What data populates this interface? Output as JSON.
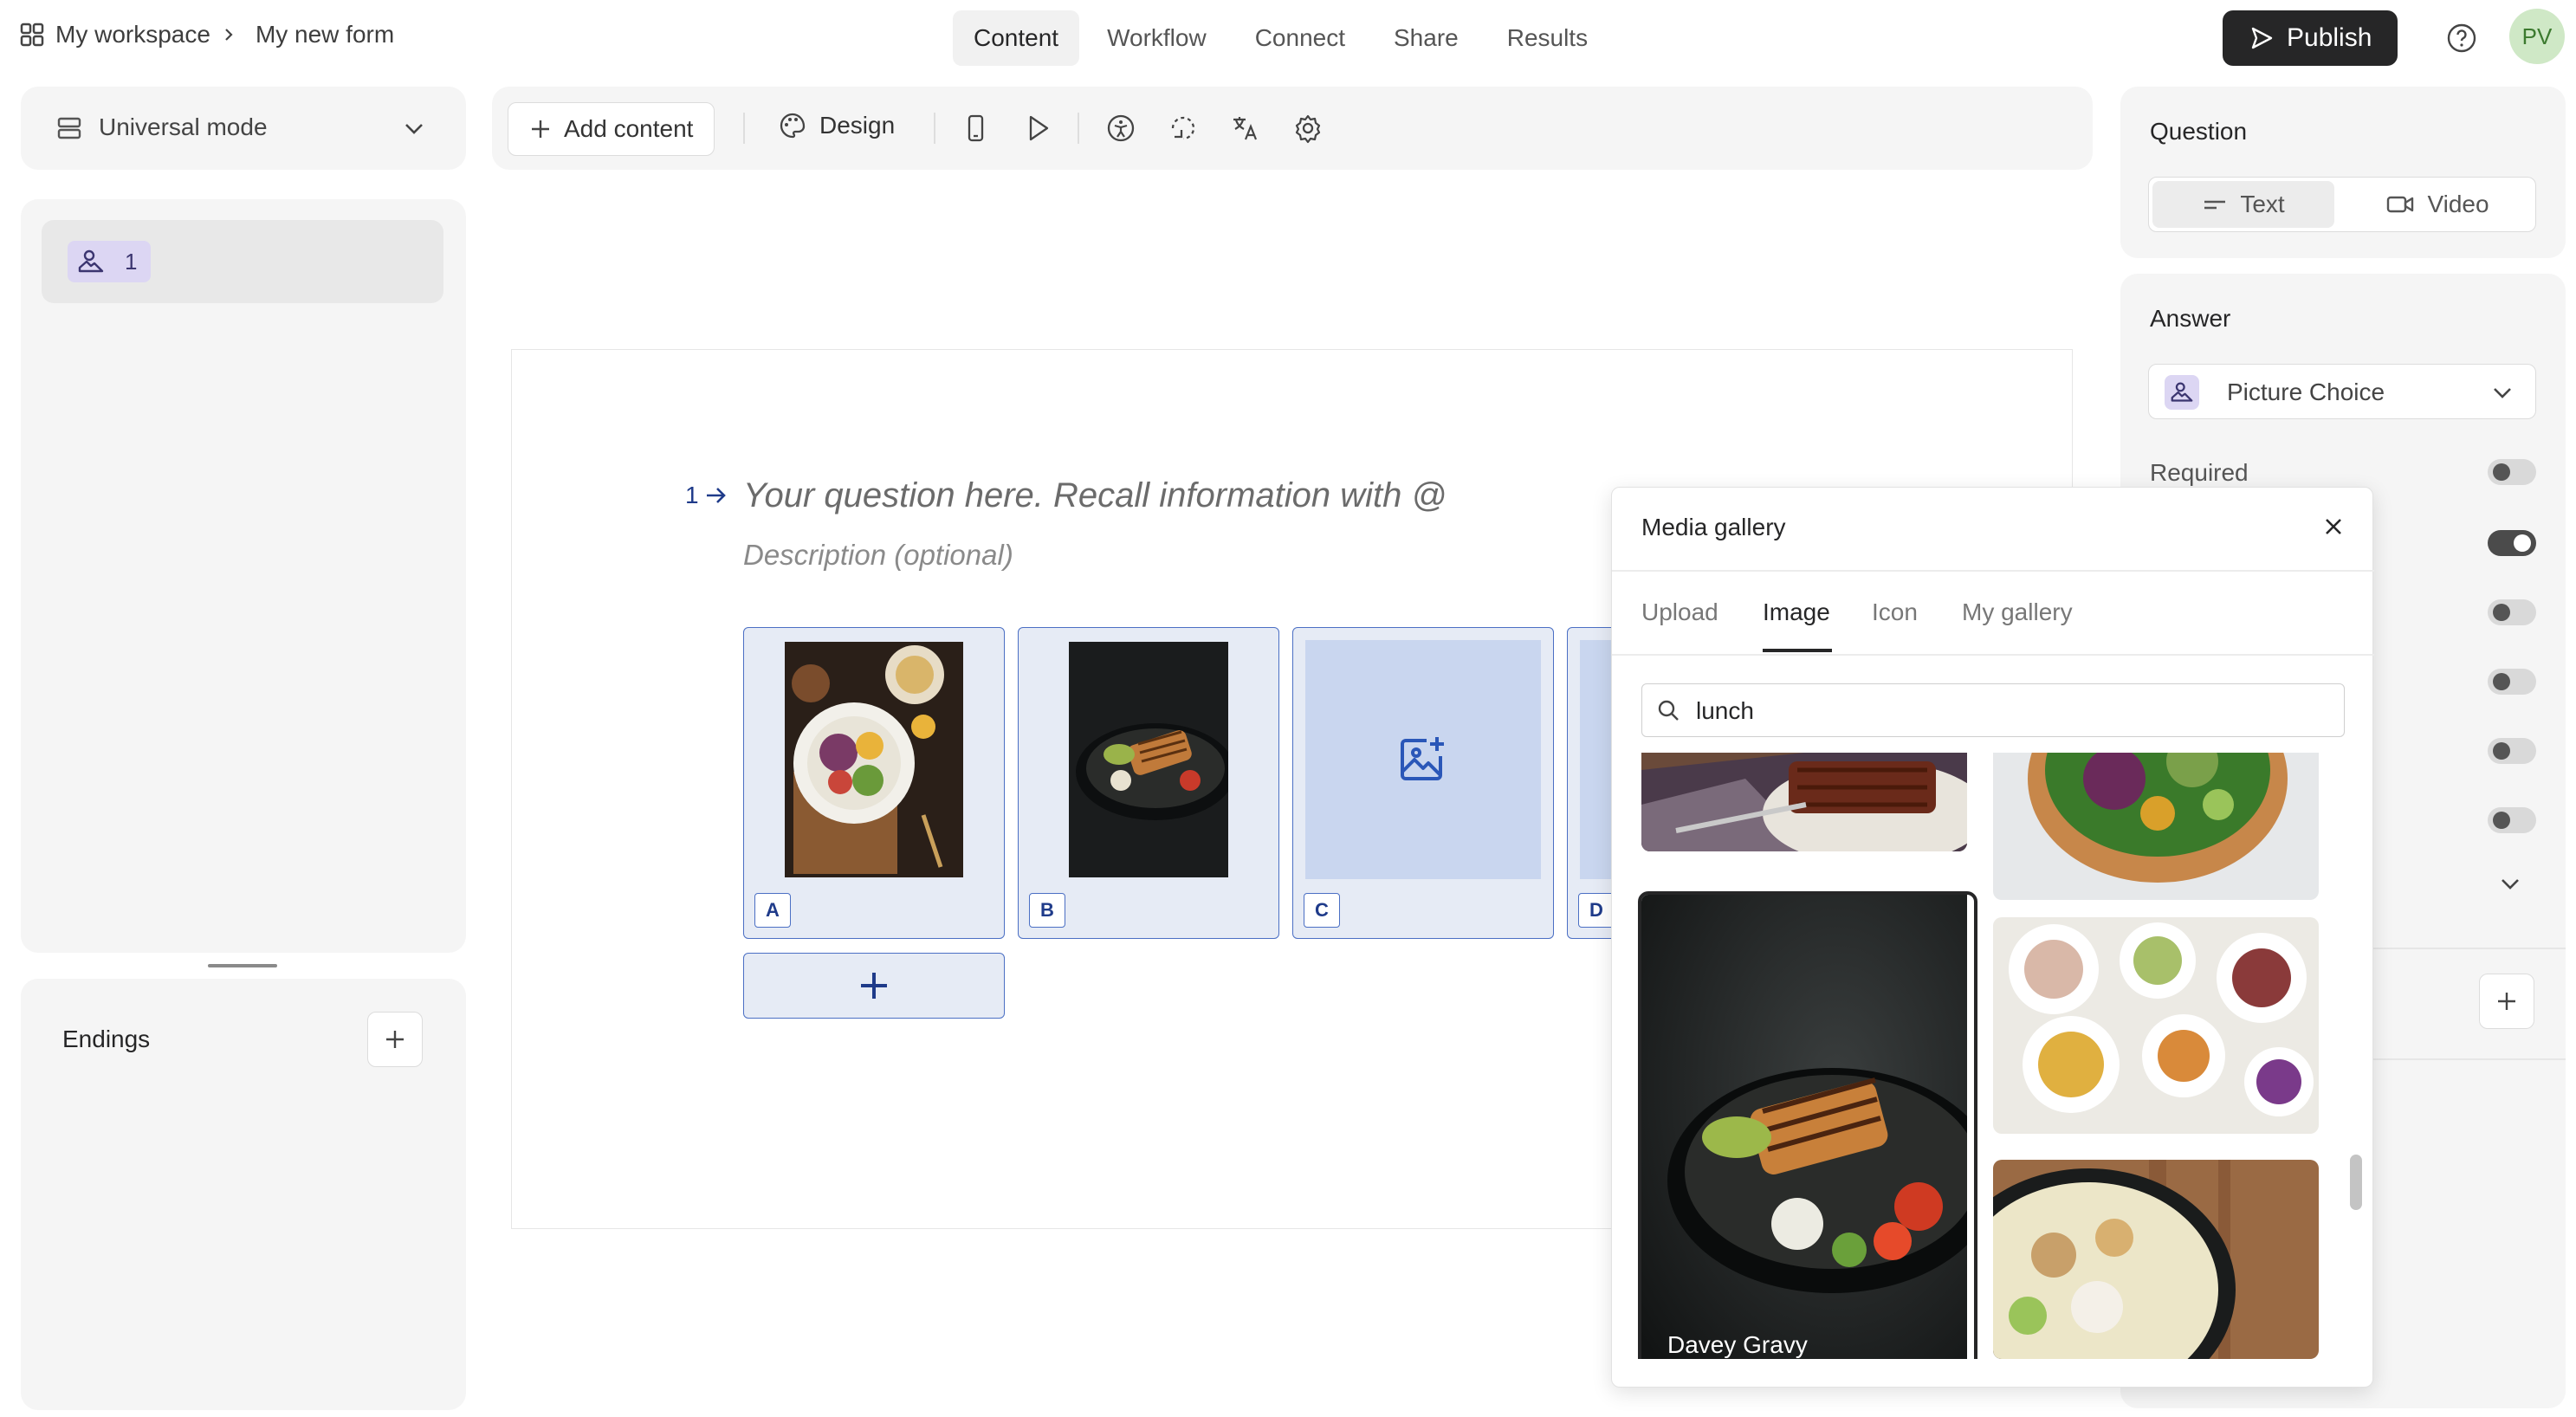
{
  "topbar": {
    "workspace": "My workspace",
    "form_name": "My new form",
    "tabs": [
      "Content",
      "Workflow",
      "Connect",
      "Share",
      "Results"
    ],
    "active_tab": "Content",
    "publish": "Publish",
    "avatar": "PV"
  },
  "left": {
    "mode": "Universal mode",
    "question_number": "1",
    "endings": "Endings"
  },
  "toolbar": {
    "add_content": "Add content",
    "design": "Design"
  },
  "question": {
    "number": "1",
    "placeholder": "Your question here. Recall information with @",
    "description": "Description (optional)",
    "choices": [
      "A",
      "B",
      "C",
      "D"
    ]
  },
  "gallery": {
    "title": "Media gallery",
    "tabs": [
      "Upload",
      "Image",
      "Icon",
      "My gallery"
    ],
    "active_tab": "Image",
    "search_value": "lunch",
    "selected_author": "Davey Gravy"
  },
  "right": {
    "question_label": "Question",
    "text": "Text",
    "video": "Video",
    "answer_label": "Answer",
    "answer_type": "Picture Choice",
    "required": "Required"
  },
  "colors": {
    "accent": "#4b6fc4",
    "publish_bg": "#262627",
    "avatar_bg": "#cfe8c6"
  }
}
